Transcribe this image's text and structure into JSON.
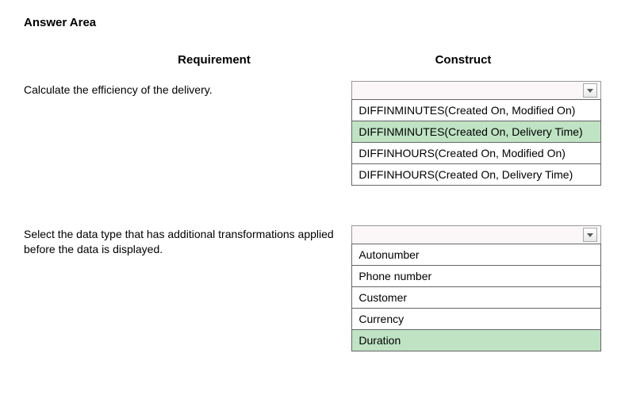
{
  "title": "Answer Area",
  "headers": {
    "requirement": "Requirement",
    "construct": "Construct"
  },
  "rows": [
    {
      "requirement": "Calculate the efficiency of the delivery.",
      "options": [
        {
          "label": "DIFFINMINUTES(Created On, Modified On)",
          "selected": false
        },
        {
          "label": "DIFFINMINUTES(Created On, Delivery Time)",
          "selected": true
        },
        {
          "label": "DIFFINHOURS(Created On, Modified On)",
          "selected": false
        },
        {
          "label": "DIFFINHOURS(Created On, Delivery Time)",
          "selected": false
        }
      ]
    },
    {
      "requirement": "Select the data type that has additional transformations applied before the data is displayed.",
      "options": [
        {
          "label": "Autonumber",
          "selected": false
        },
        {
          "label": "Phone number",
          "selected": false
        },
        {
          "label": "Customer",
          "selected": false
        },
        {
          "label": "Currency",
          "selected": false
        },
        {
          "label": "Duration",
          "selected": true
        }
      ]
    }
  ]
}
